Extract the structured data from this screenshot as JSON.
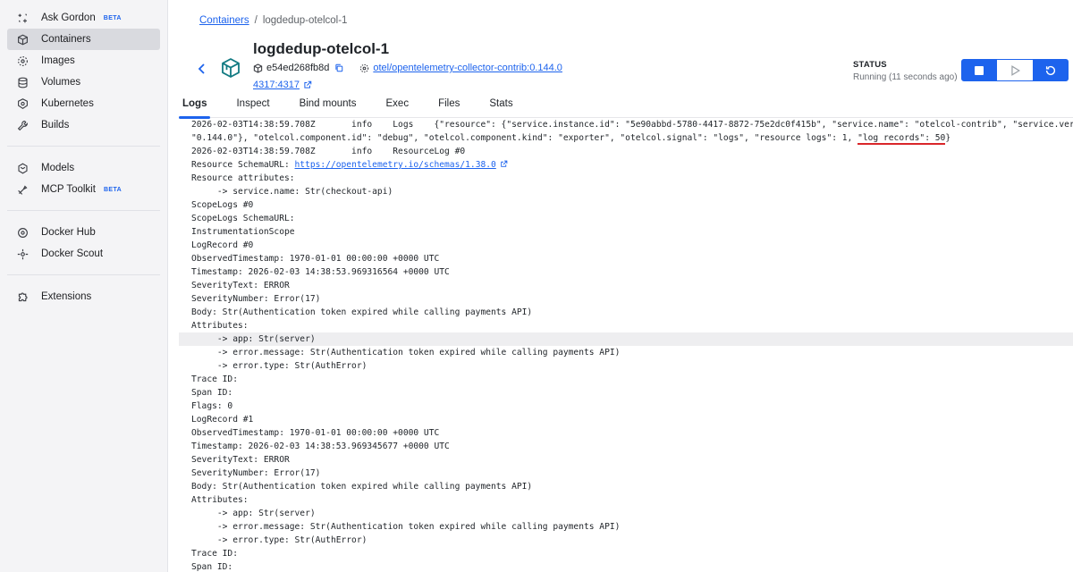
{
  "sidebar": {
    "group1": [
      {
        "label": "Ask Gordon",
        "icon": "sparkle-icon",
        "badge": "BETA"
      },
      {
        "label": "Containers",
        "icon": "container-icon",
        "active": true
      },
      {
        "label": "Images",
        "icon": "images-icon"
      },
      {
        "label": "Volumes",
        "icon": "volumes-icon"
      },
      {
        "label": "Kubernetes",
        "icon": "kubernetes-icon"
      },
      {
        "label": "Builds",
        "icon": "wrench-icon"
      }
    ],
    "group2": [
      {
        "label": "Models",
        "icon": "models-icon"
      },
      {
        "label": "MCP Toolkit",
        "icon": "toolkit-icon",
        "badge": "BETA"
      }
    ],
    "group3": [
      {
        "label": "Docker Hub",
        "icon": "hub-icon"
      },
      {
        "label": "Docker Scout",
        "icon": "scout-icon"
      }
    ],
    "group4": [
      {
        "label": "Extensions",
        "icon": "puzzle-icon"
      }
    ]
  },
  "breadcrumb": {
    "parent": "Containers",
    "current": "logdedup-otelcol-1"
  },
  "container": {
    "name": "logdedup-otelcol-1",
    "id": "e54ed268fb8d",
    "image": "otel/opentelemetry-collector-contrib:0.144.0",
    "port": "4317:4317"
  },
  "status": {
    "label": "STATUS",
    "text": "Running (11 seconds ago)"
  },
  "tabs": [
    "Logs",
    "Inspect",
    "Bind mounts",
    "Exec",
    "Files",
    "Stats"
  ],
  "logs": {
    "line1": "2026-02-03T14:38:59.708Z       info    Logs    {\"resource\": {\"service.instance.id\": \"5e90abbd-5780-4417-8872-75e2dc0f415b\", \"service.name\": \"otelcol-contrib\", \"service.version\":",
    "line2_pre": "\"0.144.0\"}, \"otelcol.component.id\": \"debug\", \"otelcol.component.kind\": \"exporter\", \"otelcol.signal\": \"logs\", \"resource logs\": 1, ",
    "line2_ul": "\"log records\": 50",
    "line2_post": "}",
    "line3": "2026-02-03T14:38:59.708Z       info    ResourceLog #0",
    "line4_pre": "Resource SchemaURL: ",
    "line4_url": "https://opentelemetry.io/schemas/1.38.0",
    "rest": [
      "Resource attributes:",
      "     -> service.name: Str(checkout-api)",
      "ScopeLogs #0",
      "ScopeLogs SchemaURL:",
      "InstrumentationScope",
      "LogRecord #0",
      "ObservedTimestamp: 1970-01-01 00:00:00 +0000 UTC",
      "Timestamp: 2026-02-03 14:38:53.969316564 +0000 UTC",
      "SeverityText: ERROR",
      "SeverityNumber: Error(17)",
      "Body: Str(Authentication token expired while calling payments API)",
      "Attributes:",
      "     -> app: Str(server)",
      "     -> error.message: Str(Authentication token expired while calling payments API)",
      "     -> error.type: Str(AuthError)",
      "Trace ID:",
      "Span ID:",
      "Flags: 0",
      "LogRecord #1",
      "ObservedTimestamp: 1970-01-01 00:00:00 +0000 UTC",
      "Timestamp: 2026-02-03 14:38:53.969345677 +0000 UTC",
      "SeverityText: ERROR",
      "SeverityNumber: Error(17)",
      "Body: Str(Authentication token expired while calling payments API)",
      "Attributes:",
      "     -> app: Str(server)",
      "     -> error.message: Str(Authentication token expired while calling payments API)",
      "     -> error.type: Str(AuthError)",
      "Trace ID:",
      "Span ID:"
    ]
  },
  "colors": {
    "accent": "#1d63ed",
    "underline": "#d9262a"
  }
}
